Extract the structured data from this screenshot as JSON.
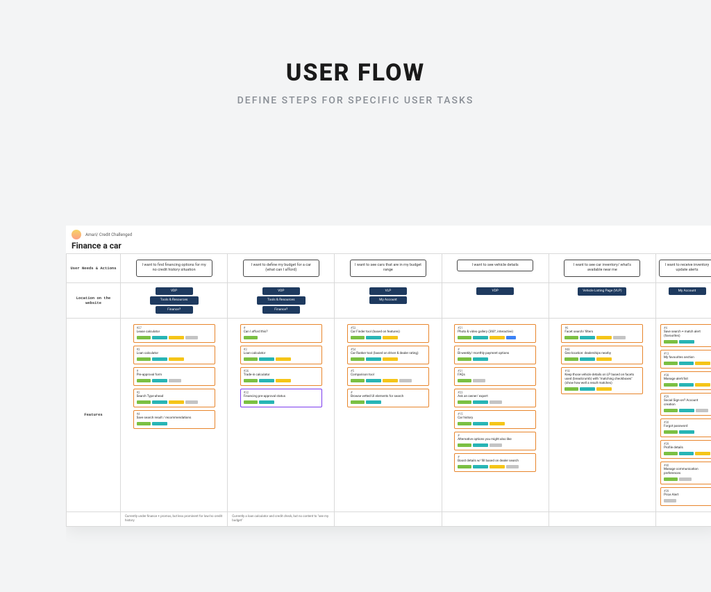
{
  "page": {
    "title": "USER FLOW",
    "subtitle": "DEFINE STEPS FOR SPECIFIC USER TASKS"
  },
  "board": {
    "persona": "Amari/ Credit Challenged",
    "title": "Finance a car",
    "row_labels": {
      "needs": "User Needs & Actions",
      "location": "Location on the website",
      "features": "Features"
    },
    "columns": [
      {
        "need": "I want to find financing options for my no credit history situation",
        "locations": [
          "VDP",
          "Tools & Resources",
          "Finance?"
        ],
        "features": [
          {
            "id": "#37",
            "title": "Lease calculator",
            "bars": [
              "green",
              "teal",
              "yellow",
              "grey"
            ]
          },
          {
            "id": "#3",
            "title": "Loan calculator",
            "bars": [
              "green",
              "teal",
              "yellow"
            ]
          },
          {
            "id": "#",
            "title": "Pre-approval form",
            "bars": [
              "green",
              "teal",
              "grey"
            ]
          },
          {
            "id": "#2",
            "title": "Search Type-ahead",
            "bars": [
              "green",
              "teal",
              "yellow",
              "grey"
            ]
          },
          {
            "id": "#4",
            "title": "Save search result / recommendations",
            "bars": [
              "green",
              "teal"
            ]
          }
        ],
        "note": "Currently under finance + promos, but less prominent for low/no credit history"
      },
      {
        "need": "I want to define my budget for a car (what can I afford)",
        "locations": [
          "VDP",
          "Tools & Resources",
          "Finance?"
        ],
        "features": [
          {
            "id": "#",
            "title": "Can I afford this?",
            "bars": [
              "green"
            ]
          },
          {
            "id": "#3",
            "title": "Loan calculator",
            "bars": [
              "green",
              "teal",
              "yellow"
            ]
          },
          {
            "id": "#36",
            "title": "Trade-in calculator",
            "bars": [
              "green",
              "teal",
              "yellow"
            ]
          },
          {
            "id": "#32",
            "title": "Financing pre-approval status",
            "bars": [
              "green",
              "teal"
            ],
            "purple": true
          }
        ],
        "note": "Currently a loan calculator and credit check, but no content to \"see my budget\""
      },
      {
        "need": "I want to see cars that are in my budget range",
        "locations": [
          "VLP",
          "My Account"
        ],
        "features": [
          {
            "id": "#53",
            "title": "Car Finder tool (based on features)",
            "bars": [
              "green",
              "teal",
              "yellow"
            ]
          },
          {
            "id": "#54",
            "title": "Car Ranker tool (based on driver & dealer rating)",
            "bars": [
              "green",
              "teal",
              "yellow"
            ]
          },
          {
            "id": "#5",
            "title": "Comparison tool",
            "bars": [
              "green",
              "teal",
              "yellow",
              "grey"
            ]
          },
          {
            "id": "#",
            "title": "Browse vetted UI elements for search",
            "bars": [
              "green",
              "teal"
            ]
          }
        ],
        "note": ""
      },
      {
        "need": "I want to see vehicle details",
        "locations": [
          "VDP"
        ],
        "features": [
          {
            "id": "#21",
            "title": "Photo & video gallery (360°, interactive)",
            "bars": [
              "green",
              "teal",
              "yellow",
              "blue"
            ]
          },
          {
            "id": "#",
            "title": "Bi-weekly/ monthly payment options",
            "bars": [
              "green",
              "teal"
            ]
          },
          {
            "id": "#31",
            "title": "FAQs",
            "bars": [
              "green",
              "grey"
            ]
          },
          {
            "id": "#23",
            "title": "Ask an owner/ expert",
            "bars": [
              "green",
              "teal",
              "grey"
            ]
          },
          {
            "id": "#15",
            "title": "Car history",
            "bars": [
              "green",
              "teal",
              "yellow"
            ]
          },
          {
            "id": "#",
            "title": "Alternative options you might also like",
            "bars": [
              "green",
              "teal",
              "grey"
            ]
          },
          {
            "id": "#",
            "title": "Boost details w/ fill based on dealer search",
            "bars": [
              "green",
              "teal",
              "yellow",
              "grey"
            ]
          }
        ],
        "note": ""
      },
      {
        "need": "I want to see car inventory/ what's available near me",
        "locations": [
          "Vehicle Listing Page (VLP)"
        ],
        "features": [
          {
            "id": "#6",
            "title": "Facet search/ filters",
            "bars": [
              "green",
              "teal",
              "yellow",
              "grey"
            ]
          },
          {
            "id": "#48",
            "title": "Geo-location: dealerships nearby",
            "bars": [
              "green",
              "teal",
              "yellow"
            ]
          },
          {
            "id": "#18",
            "title": "Keep those vehicle details on LP based on facets used (breadcrumb) with \"matching checkboxes\" (show how well a result matches)",
            "bars": [
              "green",
              "teal",
              "yellow"
            ]
          }
        ],
        "note": ""
      },
      {
        "need": "I want to receive inventory update alerts",
        "locations": [
          "My Account"
        ],
        "features": [
          {
            "id": "#4",
            "title": "Save search + match alert (favourites)",
            "bars": [
              "green",
              "teal"
            ]
          },
          {
            "id": "#13",
            "title": "My favourites section",
            "bars": [
              "green",
              "teal",
              "yellow"
            ]
          },
          {
            "id": "#38",
            "title": "Manage alert/list",
            "bars": [
              "green",
              "teal",
              "yellow"
            ]
          },
          {
            "id": "#29",
            "title": "Social Sign-on? Account creation",
            "bars": [
              "green",
              "teal",
              "grey"
            ]
          },
          {
            "id": "#30",
            "title": "Forgot password",
            "bars": [
              "green",
              "teal"
            ]
          },
          {
            "id": "#39",
            "title": "Profile details",
            "bars": [
              "green",
              "teal",
              "yellow"
            ]
          },
          {
            "id": "#40",
            "title": "Manage communication preferences",
            "bars": [
              "green",
              "grey"
            ]
          },
          {
            "id": "#39",
            "title": "Price Alert",
            "bars": [
              "grey"
            ]
          }
        ],
        "note": ""
      }
    ]
  }
}
